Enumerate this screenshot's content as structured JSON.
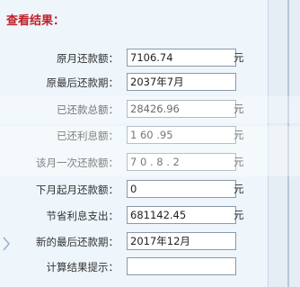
{
  "title": "查看结果：",
  "rows": [
    {
      "label": "原月还款额：",
      "value": "7106.74",
      "unit": "元"
    },
    {
      "label": "原最后还款期：",
      "value": "2037年7月",
      "unit": ""
    },
    {
      "label": "已还款总额：",
      "value": "28426.96",
      "unit": "元"
    },
    {
      "label": "已还利息额：",
      "value": "1 60 .95",
      "unit": "元"
    },
    {
      "label": "该月一次还款额：",
      "value": "7 0 . 8 . 2",
      "unit": "元"
    },
    {
      "label": "下月起月还款额：",
      "value": "0",
      "unit": "元"
    },
    {
      "label": "节省利息支出：",
      "value": "681142.45",
      "unit": "元"
    },
    {
      "label": "新的最后还款期：",
      "value": "2017年12月",
      "unit": ""
    },
    {
      "label": "计算结果提示：",
      "value": "",
      "unit": ""
    }
  ],
  "icons": {
    "left_arrow": "chevron-right-icon"
  }
}
